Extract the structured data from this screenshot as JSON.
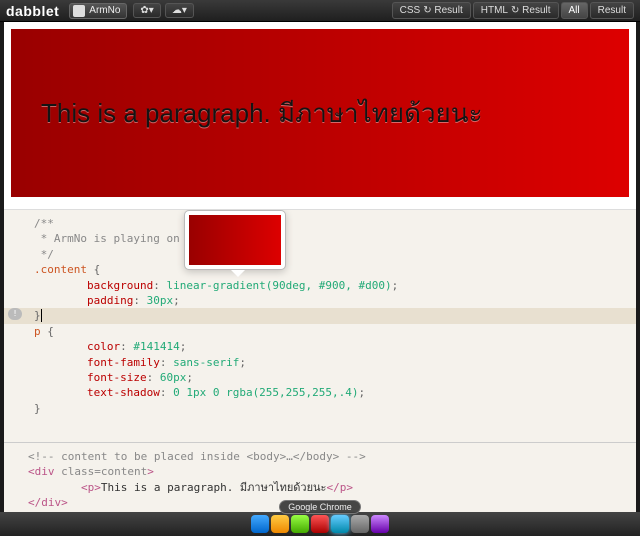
{
  "topbar": {
    "logo": "dabblet",
    "username": "ArmNo",
    "gear_caret": "▾",
    "cloud_caret": "▾",
    "tabs": [
      {
        "label": "CSS",
        "refresh": true
      },
      {
        "label": "Result"
      },
      {
        "label": "HTML",
        "refresh": true
      },
      {
        "label": "Result"
      },
      {
        "label": "All",
        "active": true
      },
      {
        "label": "Result"
      }
    ]
  },
  "result": {
    "paragraph": "This is a paragraph. มีภาษาไทยด้วยนะ"
  },
  "css_code": {
    "c1": "/**",
    "c2": " * ArmNo is playing on dabb",
    "c3": " */",
    "sel1": ".content",
    "brace_o": " {",
    "p1": "background",
    "v1": "linear-gradient(90deg, #900, #d00)",
    "p2": "padding",
    "v2": "30px",
    "brace_c": "}",
    "sel2": "p",
    "p3": "color",
    "v3": "#141414",
    "p4": "font-family",
    "v4": "sans-serif",
    "p5": "font-size",
    "v5": "60px",
    "p6": "text-shadow",
    "v6": "0 1px 0 rgba(255,255,255,.4)",
    "semi": ";",
    "colon": ": "
  },
  "html_code": {
    "comment": "<!-- content to be placed inside <body>…</body> -->",
    "l2_open": "<div ",
    "l2_attr": "class=content",
    "l2_close": ">",
    "l3_open": "<p>",
    "l3_text": "This is a paragraph. มีภาษาไทยด้วยนะ",
    "l3_close": "</p>",
    "l4": "</div>"
  },
  "dock": {
    "tooltip": "Google Chrome"
  }
}
